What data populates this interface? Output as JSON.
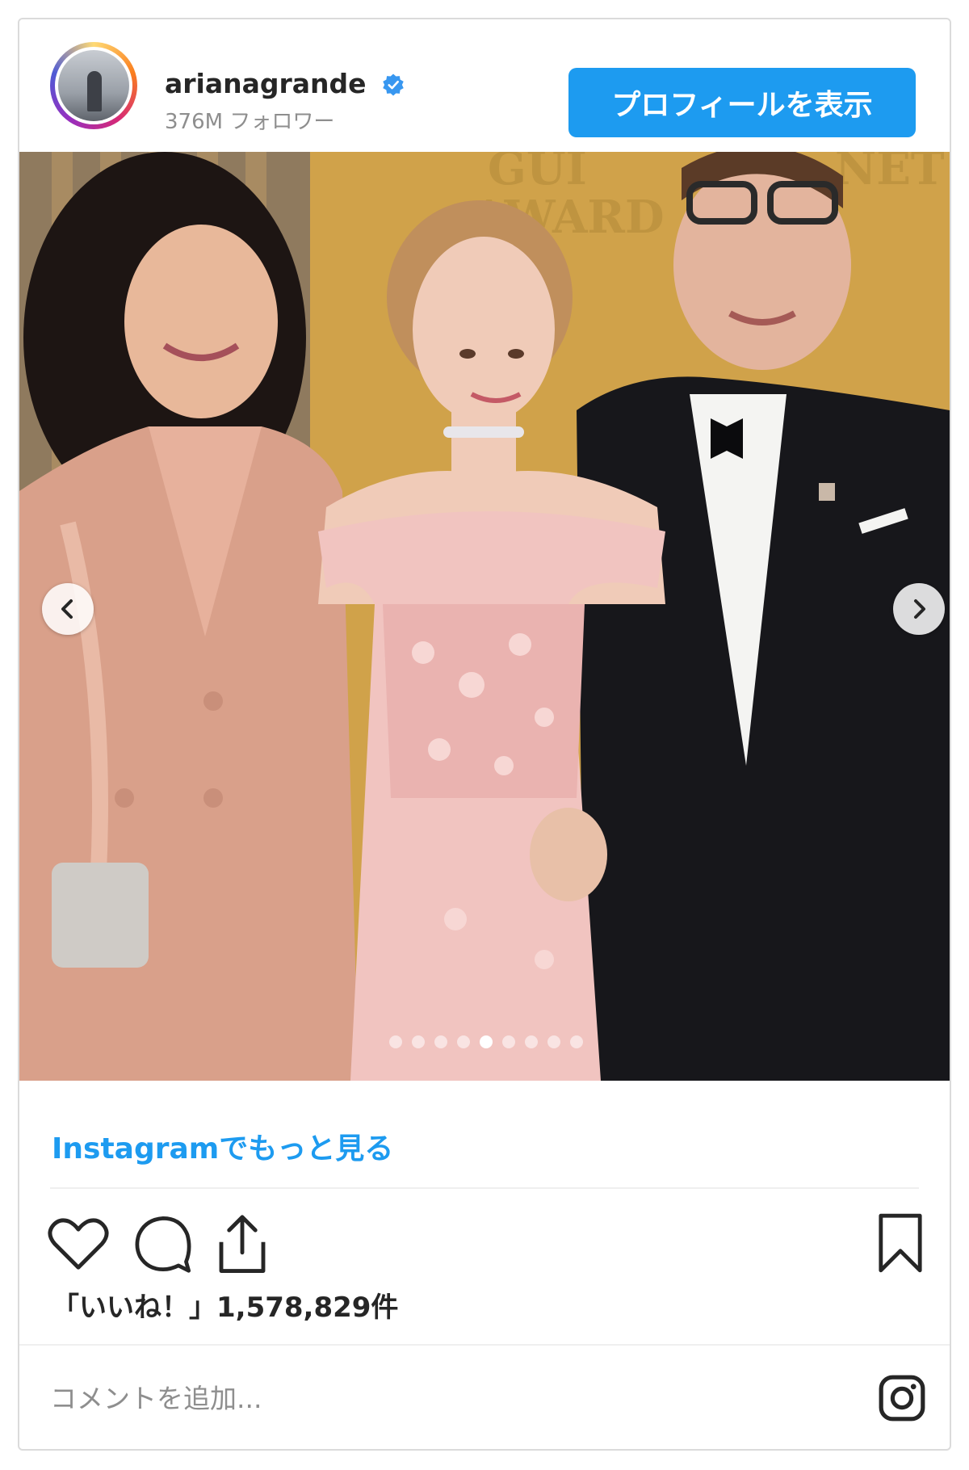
{
  "header": {
    "username": "arianagrande",
    "followers": "376M フォロワー",
    "profile_button": "プロフィールを表示"
  },
  "carousel": {
    "dot_count": 9,
    "active_index": 4
  },
  "links": {
    "more_on_instagram": "Instagramでもっと見る"
  },
  "stats": {
    "likes": "「いいね！」1,578,829件"
  },
  "comment": {
    "placeholder": "コメントを追加..."
  },
  "icons": {
    "verified": "verified-badge-icon",
    "prev": "chevron-left-icon",
    "next": "chevron-right-icon",
    "like": "heart-icon",
    "comment": "comment-bubble-icon",
    "share": "share-icon",
    "save": "bookmark-icon",
    "instagram": "instagram-logo-icon"
  },
  "colors": {
    "accent": "#1d9bf0",
    "verified": "#3897f0",
    "text": "#262626",
    "muted": "#8e8e8e"
  }
}
